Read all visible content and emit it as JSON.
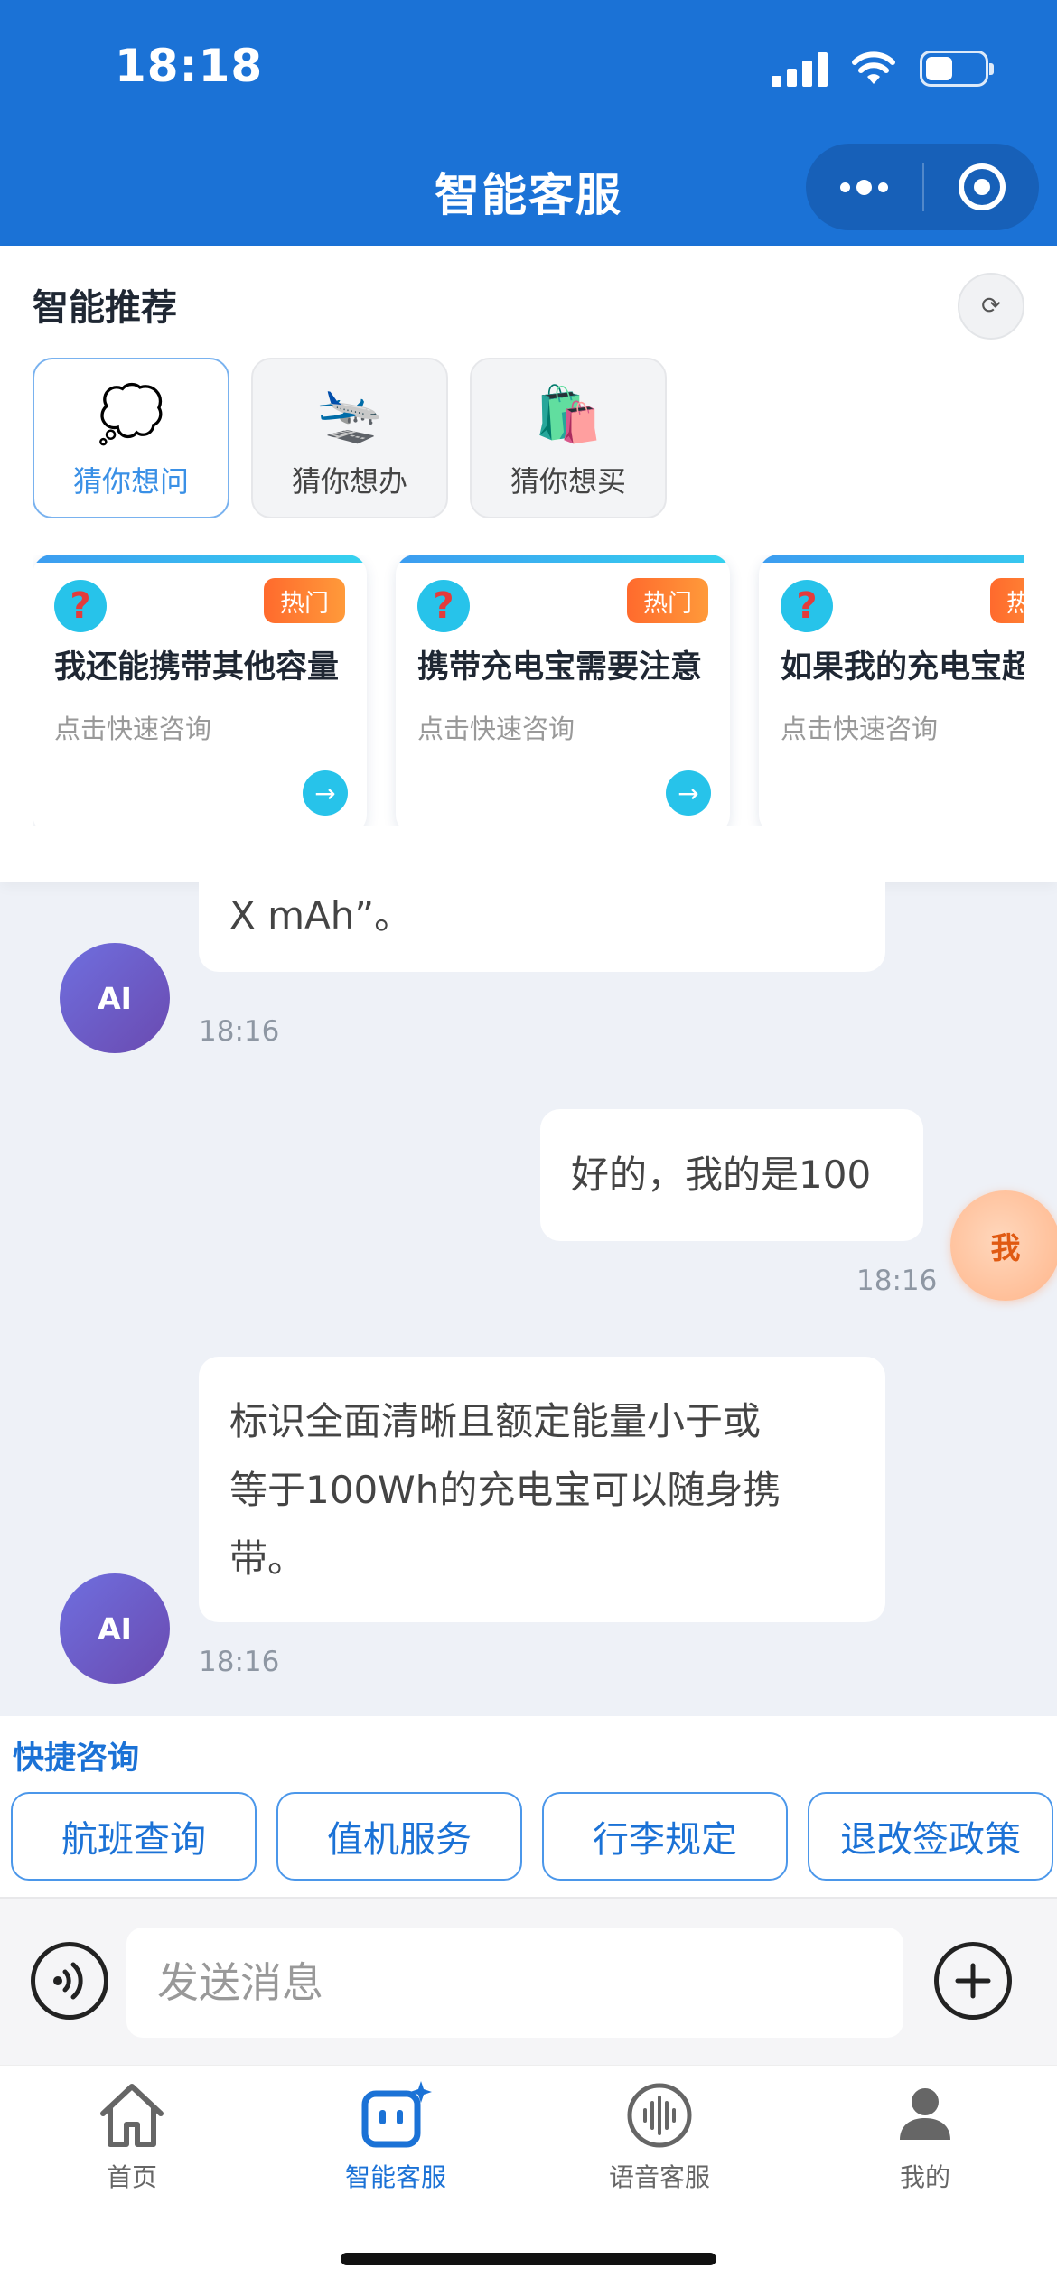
{
  "status_bar": {
    "time": "18:18"
  },
  "header": {
    "title": "智能客服"
  },
  "recommend": {
    "title": "智能推荐",
    "refresh_glyph": "⟳",
    "tabs": [
      {
        "label": "猜你想问",
        "emoji": "💭"
      },
      {
        "label": "猜你想办",
        "emoji": "🛬"
      },
      {
        "label": "猜你想买",
        "emoji": "🛍️"
      }
    ],
    "cards": [
      {
        "question": "我还能携带其他容量",
        "badge": "热门",
        "subtitle": "点击快速咨询"
      },
      {
        "question": "携带充电宝需要注意",
        "badge": "热门",
        "subtitle": "点击快速咨询"
      },
      {
        "question": "如果我的充电宝超",
        "badge": "热门",
        "subtitle": "点击快速咨询"
      }
    ]
  },
  "chat": {
    "ai_avatar_label": "AI",
    "user_avatar_label": "我",
    "messages": [
      {
        "sender": "ai",
        "text": "X mAh”。",
        "time": "18:16"
      },
      {
        "sender": "user",
        "text": "好的，我的是100",
        "time": "18:16"
      },
      {
        "sender": "ai",
        "lines": [
          "标识全面清晰且额定能量小于或",
          "等于100Wh的充电宝可以随身携",
          "带。"
        ],
        "time": "18:16"
      }
    ]
  },
  "quick_consult": {
    "title": "快捷咨询",
    "buttons": [
      "航班查询",
      "值机服务",
      "行李规定",
      "退改签政策"
    ]
  },
  "input": {
    "placeholder": "发送消息"
  },
  "tabbar": {
    "items": [
      {
        "label": "首页"
      },
      {
        "label": "智能客服"
      },
      {
        "label": "语音客服"
      },
      {
        "label": "我的"
      }
    ]
  },
  "colors": {
    "primary": "#1b72d6",
    "hot_badge": "#ff7a33",
    "question_icon": "#27c3ea",
    "ai_avatar": "#6a5ad0",
    "user_avatar": "#ffc09a"
  }
}
